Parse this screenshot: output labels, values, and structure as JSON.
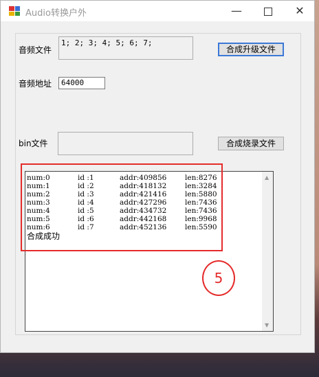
{
  "window": {
    "title": "Audio转换户外"
  },
  "form": {
    "audio_file_label": "音频文件",
    "audio_file_value": "1; 2; 3; 4; 5; 6; 7;",
    "merge_upgrade_button": "合成升级文件",
    "audio_address_label": "音频地址",
    "audio_address_value": "64000",
    "bin_file_label": "bin文件",
    "bin_file_value": "",
    "merge_burn_button": "合成烧录文件"
  },
  "output": {
    "rows": [
      {
        "num": "num:0",
        "id": "id :1",
        "addr": "addr:409856",
        "len": "len:8276"
      },
      {
        "num": "num:1",
        "id": "id :2",
        "addr": "addr:418132",
        "len": "len:3284"
      },
      {
        "num": "num:2",
        "id": "id :3",
        "addr": "addr:421416",
        "len": "len:5880"
      },
      {
        "num": "num:3",
        "id": "id :4",
        "addr": "addr:427296",
        "len": "len:7436"
      },
      {
        "num": "num:4",
        "id": "id :5",
        "addr": "addr:434732",
        "len": "len:7436"
      },
      {
        "num": "num:5",
        "id": "id :6",
        "addr": "addr:442168",
        "len": "len:9968"
      },
      {
        "num": "num:6",
        "id": "id :7",
        "addr": "addr:452136",
        "len": "len:5590"
      }
    ],
    "status": "合成成功"
  },
  "annotation": {
    "step_number": "5",
    "color": "#e52a2a"
  },
  "colors": {
    "accent": "#3b78d8"
  }
}
